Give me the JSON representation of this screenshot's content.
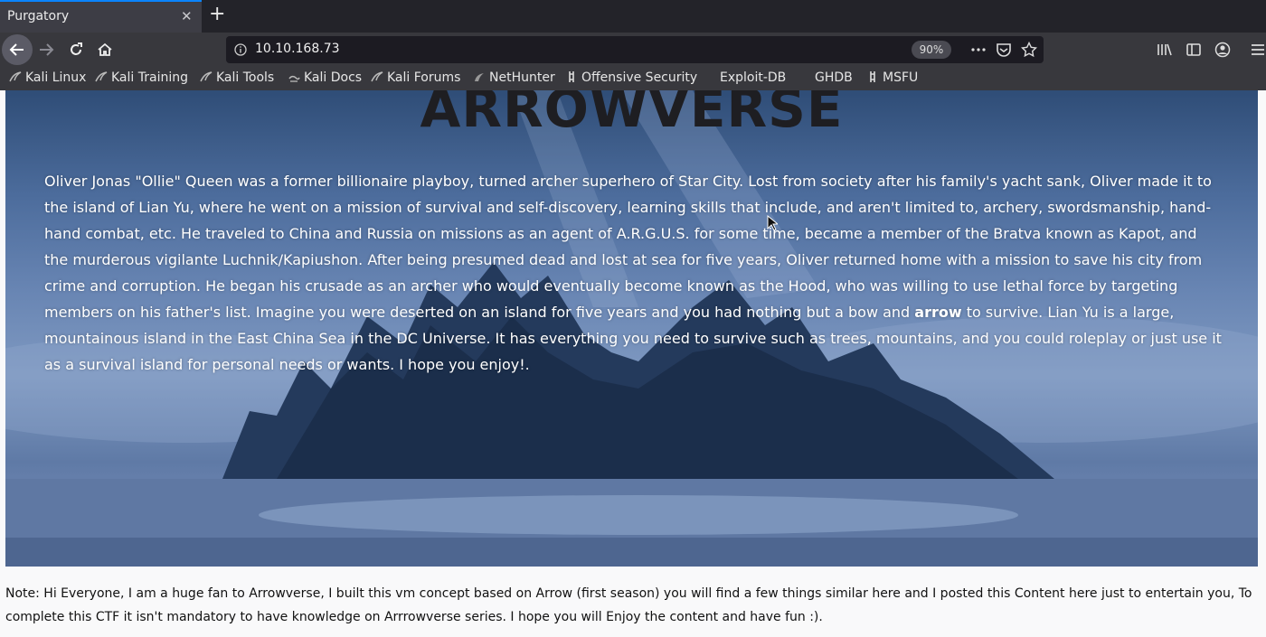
{
  "browser": {
    "tab_title": "Purgatory",
    "tab_close": "✕",
    "new_tab": "+",
    "url": "10.10.168.73",
    "zoom": "90%",
    "accent": "#0a84ff"
  },
  "bookmarks": [
    {
      "label": "Kali Linux",
      "icon": "kali-icon"
    },
    {
      "label": "Kali Training",
      "icon": "kali-icon"
    },
    {
      "label": "Kali Tools",
      "icon": "kali-icon"
    },
    {
      "label": "Kali Docs",
      "icon": "docs-icon"
    },
    {
      "label": "Kali Forums",
      "icon": "kali-icon"
    },
    {
      "label": "NetHunter",
      "icon": "nethunter-icon"
    },
    {
      "label": "Offensive Security",
      "icon": "offsec-icon"
    },
    {
      "label": "Exploit-DB",
      "icon": "exploitdb-icon"
    },
    {
      "label": "GHDB",
      "icon": "ghdb-icon"
    },
    {
      "label": "MSFU",
      "icon": "offsec-icon"
    }
  ],
  "page": {
    "title": "ARROWVERSE",
    "text_before": "Oliver Jonas \"Ollie\" Queen was a former billionaire playboy, turned archer superhero of Star City. Lost from society after his family's yacht sank, Oliver made it to the island of Lian Yu, where he went on a mission of survival and self-discovery, learning skills that include, and aren't limited to, archery, swordsmanship, hand-hand combat, etc. He traveled to China and Russia on missions as an agent of A.R.G.U.S. for some time, became a member of the Bratva known as Kapot, and the murderous vigilante Luchnik/Kapiushon. After being presumed dead and lost at sea for five years, Oliver returned home with a mission to save his city from crime and corruption. He began his crusade as an archer who would eventually become known as the Hood, who was willing to use lethal force by targeting members on his father's list. Imagine you were deserted on an island for five years and you had nothing but a bow and ",
    "text_bold": "arrow",
    "text_after": " to survive. Lian Yu is a large, mountainous island in the East China Sea in the DC Universe. It has everything you need to survive such as trees, mountains, and you could roleplay or just use it as a survival island for personal needs or wants. I hope you enjoy!.",
    "note": "Note: Hi Everyone, I am a huge fan to Arrowverse, I built this vm concept based on Arrow (first season) you will find a few things similar here and I posted this Content here just to entertain you, To complete this CTF it isn't mandatory to have knowledge on Arrrowverse series. I hope you will Enjoy the content and have fun :)."
  }
}
